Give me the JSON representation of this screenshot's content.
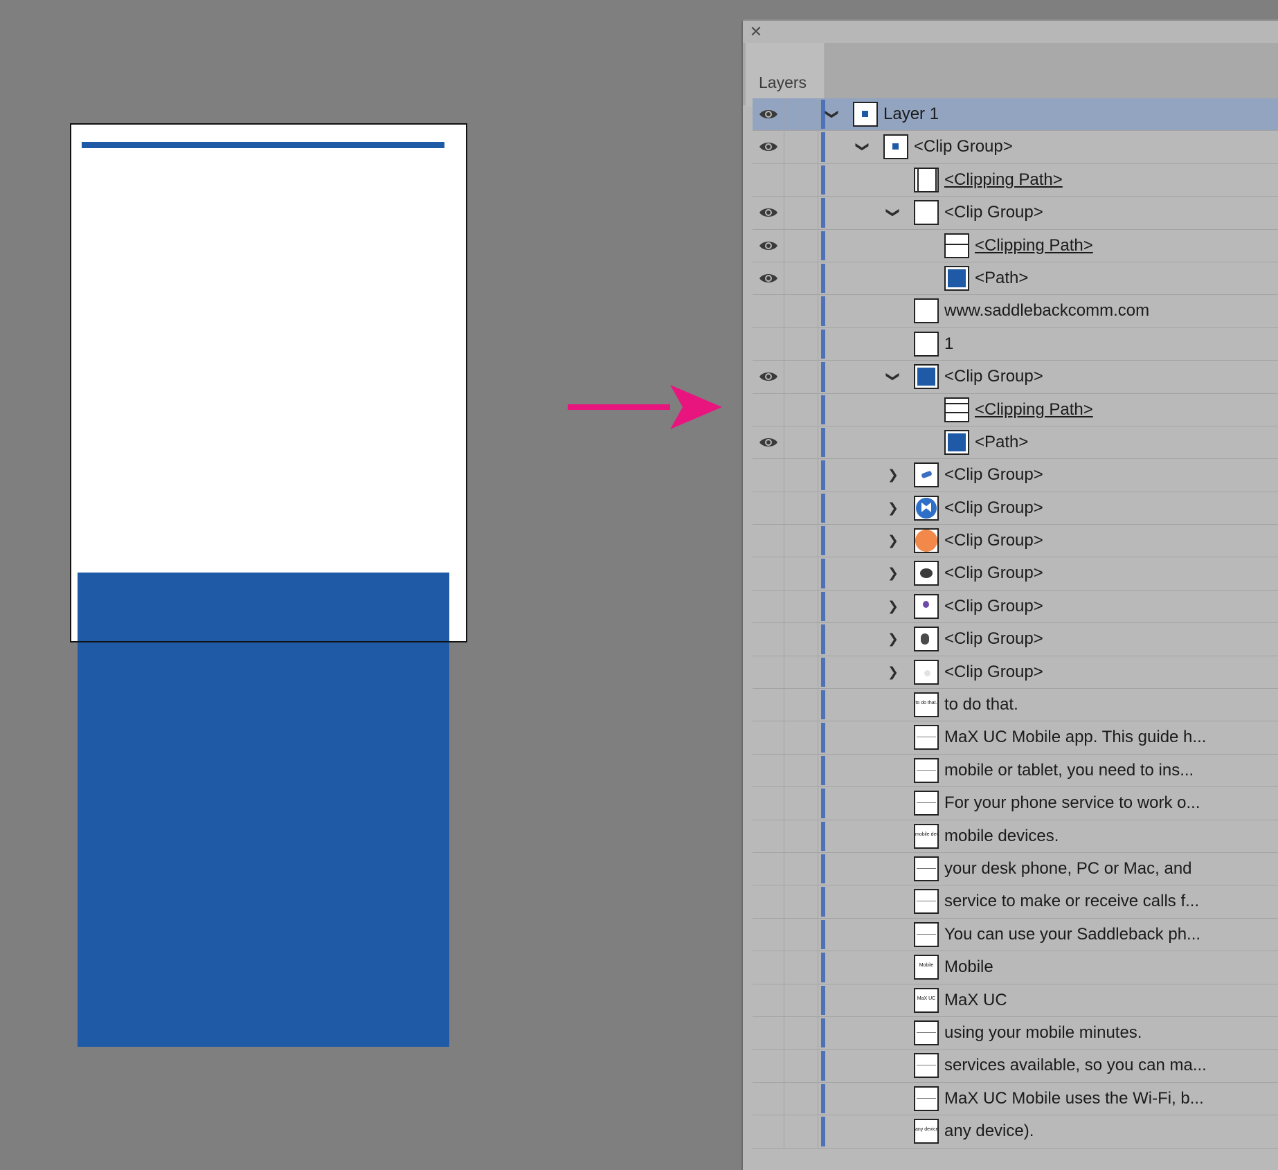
{
  "panel": {
    "tab_label": "Layers",
    "close_glyph": "✕"
  },
  "colors": {
    "canvas_bg": "#7f7f7f",
    "artboard": "#ffffff",
    "brand_blue": "#1f5aa6",
    "arrow": "#e8157f",
    "panel_bg": "#b9b9b9",
    "selected_row": "#92a4bf",
    "layer_color_bar": "#4f72b6"
  },
  "layers": [
    {
      "label": "Layer 1",
      "depth": 0,
      "twirl": "open",
      "eye": true,
      "thumb": "dot",
      "selected": true
    },
    {
      "label": "<Clip Group>",
      "depth": 1,
      "twirl": "open",
      "eye": true,
      "thumb": "dot"
    },
    {
      "label": "<Clipping Path>",
      "depth": 2,
      "twirl": "none",
      "eye": false,
      "thumb": "frame",
      "underline": true
    },
    {
      "label": "<Clip Group>",
      "depth": 2,
      "twirl": "open",
      "eye": true,
      "thumb": "blank"
    },
    {
      "label": "<Clipping Path>",
      "depth": 3,
      "twirl": "none",
      "eye": true,
      "thumb": "line",
      "underline": true
    },
    {
      "label": "<Path>",
      "depth": 3,
      "twirl": "none",
      "eye": true,
      "thumb": "blue"
    },
    {
      "label": "www.saddlebackcomm.com",
      "depth": 2,
      "twirl": "none",
      "eye": false,
      "thumb": "blank"
    },
    {
      "label": "1",
      "depth": 2,
      "twirl": "none",
      "eye": false,
      "thumb": "blank"
    },
    {
      "label": "<Clip Group>",
      "depth": 2,
      "twirl": "open",
      "eye": true,
      "thumb": "blue"
    },
    {
      "label": "<Clipping Path>",
      "depth": 3,
      "twirl": "none",
      "eye": false,
      "thumb": "line2",
      "underline": true
    },
    {
      "label": "<Path>",
      "depth": 3,
      "twirl": "none",
      "eye": true,
      "thumb": "blue"
    },
    {
      "label": "<Clip Group>",
      "depth": 2,
      "twirl": "closed",
      "eye": false,
      "thumb": "phone"
    },
    {
      "label": "<Clip Group>",
      "depth": 2,
      "twirl": "closed",
      "eye": false,
      "thumb": "bluecircle"
    },
    {
      "label": "<Clip Group>",
      "depth": 2,
      "twirl": "closed",
      "eye": false,
      "thumb": "orange"
    },
    {
      "label": "<Clip Group>",
      "depth": 2,
      "twirl": "closed",
      "eye": false,
      "thumb": "darkimg"
    },
    {
      "label": "<Clip Group>",
      "depth": 2,
      "twirl": "closed",
      "eye": false,
      "thumb": "purple"
    },
    {
      "label": "<Clip Group>",
      "depth": 2,
      "twirl": "closed",
      "eye": false,
      "thumb": "person"
    },
    {
      "label": "<Clip Group>",
      "depth": 2,
      "twirl": "closed",
      "eye": false,
      "thumb": "faint"
    },
    {
      "label": "to do that.",
      "depth": 2,
      "twirl": "none",
      "eye": false,
      "thumb": "text",
      "thumb_text": "to do that."
    },
    {
      "label": "MaX UC Mobile app. This guide h...",
      "depth": 2,
      "twirl": "none",
      "eye": false,
      "thumb": "textline"
    },
    {
      "label": "mobile or tablet, you need to ins...",
      "depth": 2,
      "twirl": "none",
      "eye": false,
      "thumb": "textline"
    },
    {
      "label": "For your phone service to work o...",
      "depth": 2,
      "twirl": "none",
      "eye": false,
      "thumb": "textline"
    },
    {
      "label": "mobile devices.",
      "depth": 2,
      "twirl": "none",
      "eye": false,
      "thumb": "text",
      "thumb_text": "mobile devices."
    },
    {
      "label": "your desk phone, PC or Mac, and",
      "depth": 2,
      "twirl": "none",
      "eye": false,
      "thumb": "textline"
    },
    {
      "label": "service to make or receive calls f...",
      "depth": 2,
      "twirl": "none",
      "eye": false,
      "thumb": "textline"
    },
    {
      "label": "You can use your Saddleback ph...",
      "depth": 2,
      "twirl": "none",
      "eye": false,
      "thumb": "textline"
    },
    {
      "label": "Mobile",
      "depth": 2,
      "twirl": "none",
      "eye": false,
      "thumb": "text",
      "thumb_text": "Mobile"
    },
    {
      "label": "MaX UC",
      "depth": 2,
      "twirl": "none",
      "eye": false,
      "thumb": "text",
      "thumb_text": "MaX UC"
    },
    {
      "label": "using your mobile minutes.",
      "depth": 2,
      "twirl": "none",
      "eye": false,
      "thumb": "textline"
    },
    {
      "label": "services available, so you can ma...",
      "depth": 2,
      "twirl": "none",
      "eye": false,
      "thumb": "textline"
    },
    {
      "label": "MaX UC Mobile uses the Wi-Fi, b...",
      "depth": 2,
      "twirl": "none",
      "eye": false,
      "thumb": "textline"
    },
    {
      "label": "any device).",
      "depth": 2,
      "twirl": "none",
      "eye": false,
      "thumb": "text",
      "thumb_text": "any device)."
    }
  ]
}
